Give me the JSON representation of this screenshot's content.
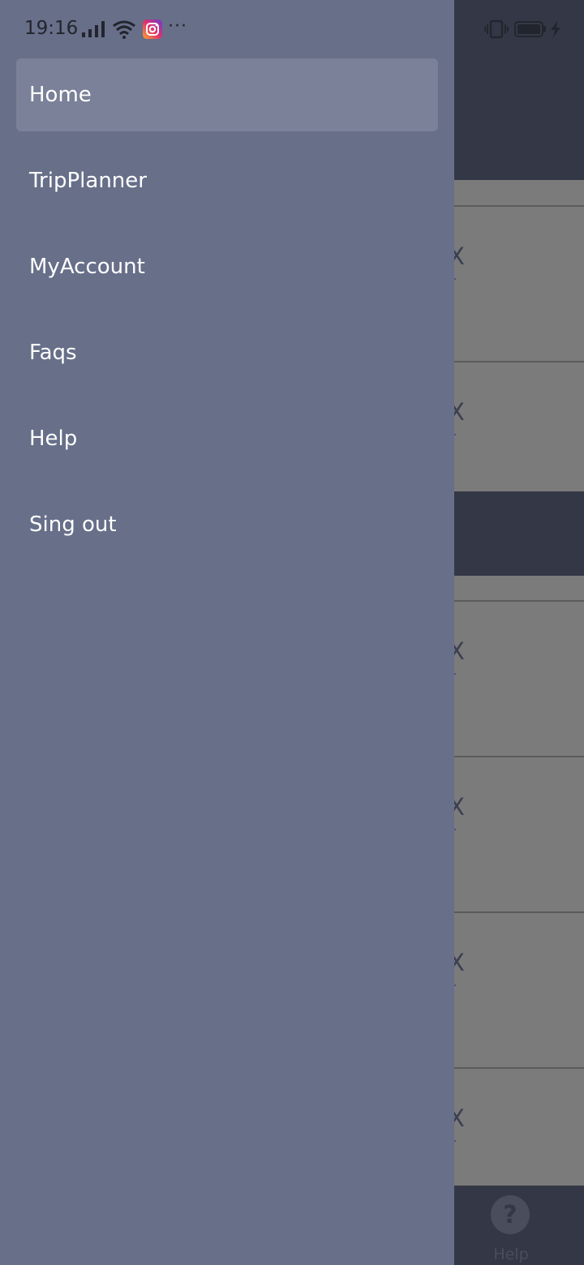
{
  "status_bar": {
    "time": "19:16",
    "more_label": "···",
    "icons": [
      "signal-icon",
      "wifi-icon",
      "instagram-icon",
      "vibrate-icon",
      "battery-icon",
      "charging-icon"
    ]
  },
  "drawer": {
    "items": [
      {
        "label": "Home",
        "active": true
      },
      {
        "label": "TripPlanner",
        "active": false
      },
      {
        "label": "MyAccount",
        "active": false
      },
      {
        "label": "Faqs",
        "active": false
      },
      {
        "label": "Help",
        "active": false
      },
      {
        "label": "Sing out",
        "active": false
      }
    ]
  },
  "background": {
    "card_text": "e X",
    "bottom_tab": {
      "label": "Help",
      "icon": "question-icon",
      "glyph": "?"
    }
  },
  "colors": {
    "drawer_bg": "#676f89",
    "active_item_bg": "#7b8198",
    "header_bg": "#343846",
    "scrim_card": "#7b7b7b"
  }
}
